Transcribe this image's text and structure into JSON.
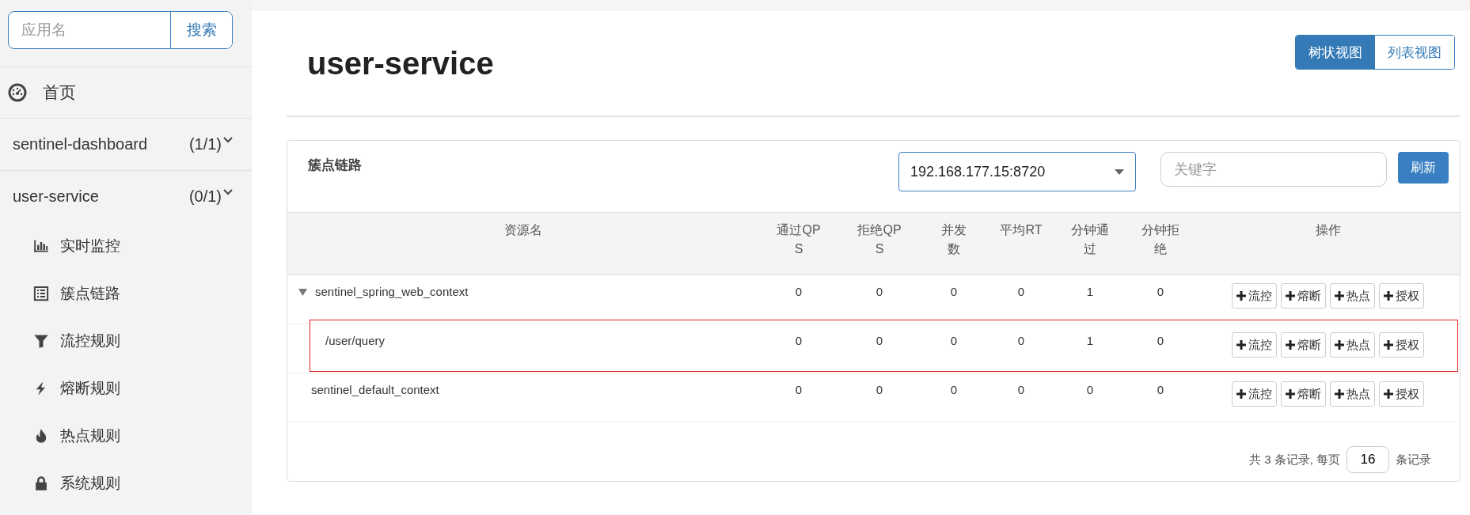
{
  "sidebar": {
    "search": {
      "placeholder": "应用名",
      "button": "搜索"
    },
    "home": {
      "label": "首页"
    },
    "apps": [
      {
        "name": "sentinel-dashboard",
        "count": "(1/1)"
      },
      {
        "name": "user-service",
        "count": "(0/1)",
        "items": [
          {
            "label": "实时监控"
          },
          {
            "label": "簇点链路"
          },
          {
            "label": "流控规则"
          },
          {
            "label": "熔断规则"
          },
          {
            "label": "热点规则"
          },
          {
            "label": "系统规则"
          }
        ]
      }
    ]
  },
  "main": {
    "title": "user-service",
    "view_toggle": [
      {
        "label": "树状视图",
        "selected": true
      },
      {
        "label": "列表视图",
        "selected": false
      }
    ],
    "panel": {
      "title": "簇点链路",
      "machine_select": "192.168.177.15:8720",
      "keyword": {
        "placeholder": "关键字"
      },
      "refresh_button": "刷新",
      "columns": [
        "资源名",
        "通过QPS",
        "拒绝QPS",
        "并发数",
        "平均RT",
        "分钟通过",
        "分钟拒绝",
        "操作"
      ],
      "rows": [
        {
          "resource": "sentinel_spring_web_context",
          "values": [
            "0",
            "0",
            "0",
            "0",
            "1",
            "0"
          ],
          "actions": [
            "流控",
            "熔断",
            "热点",
            "授权"
          ],
          "expanded": true,
          "highlighted": false,
          "children": [
            {
              "resource": "/user/query",
              "values": [
                "0",
                "0",
                "0",
                "0",
                "1",
                "0"
              ],
              "actions": [
                "流控",
                "熔断",
                "热点",
                "授权"
              ],
              "highlighted": true
            }
          ]
        },
        {
          "resource": "sentinel_default_context",
          "values": [
            "0",
            "0",
            "0",
            "0",
            "0",
            "0"
          ],
          "actions": [
            "流控",
            "熔断",
            "热点",
            "授权"
          ],
          "highlighted": false
        }
      ],
      "pagination": {
        "prefix": "共 3 条记录, 每页",
        "page_size": "16",
        "suffix": "条记录"
      }
    }
  }
}
